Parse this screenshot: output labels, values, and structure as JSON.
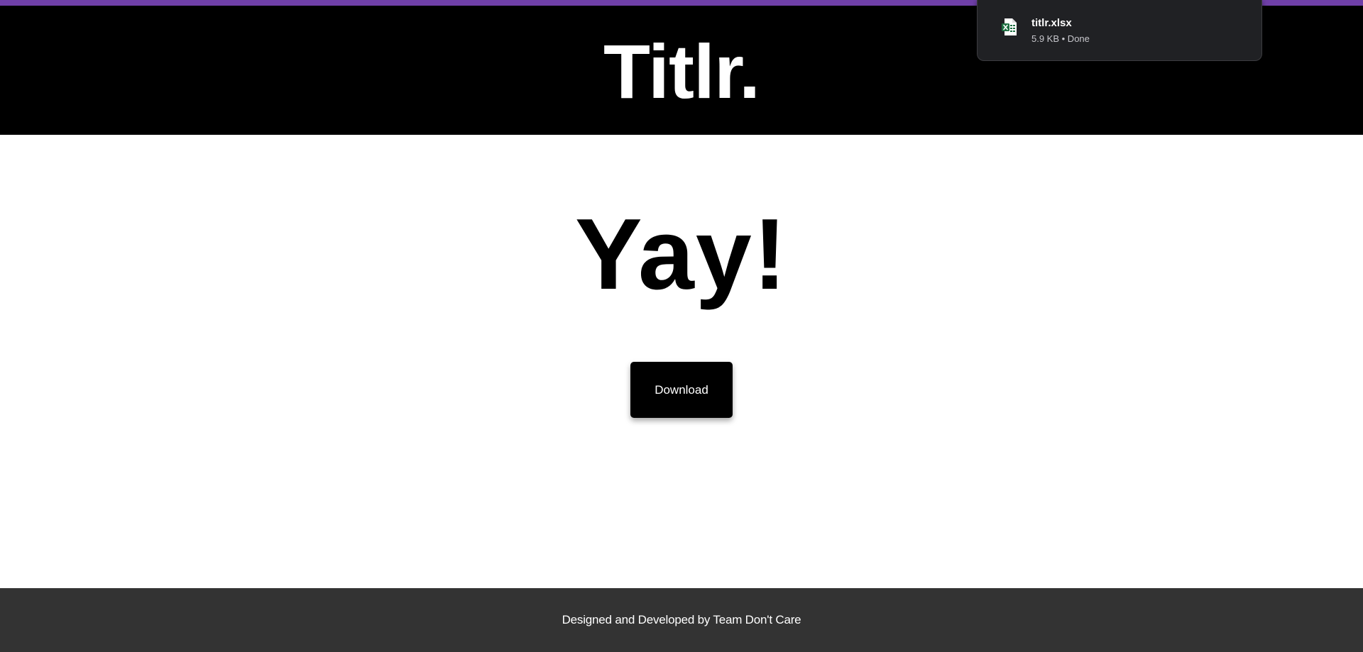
{
  "header": {
    "brand": "Titlr."
  },
  "main": {
    "headline": "Yay!",
    "download_label": "Download"
  },
  "footer": {
    "credit": "Designed and Developed by Team Don't Care"
  },
  "download_toast": {
    "file_name": "titlr.xlsx",
    "file_meta": "5.9 KB • Done",
    "icon": "excel-file-icon"
  },
  "colors": {
    "accent_strip": "#6f3fa8",
    "header_bg": "#000000",
    "footer_bg": "#333333",
    "toast_bg": "#202124",
    "excel_green": "#1d6f42"
  }
}
